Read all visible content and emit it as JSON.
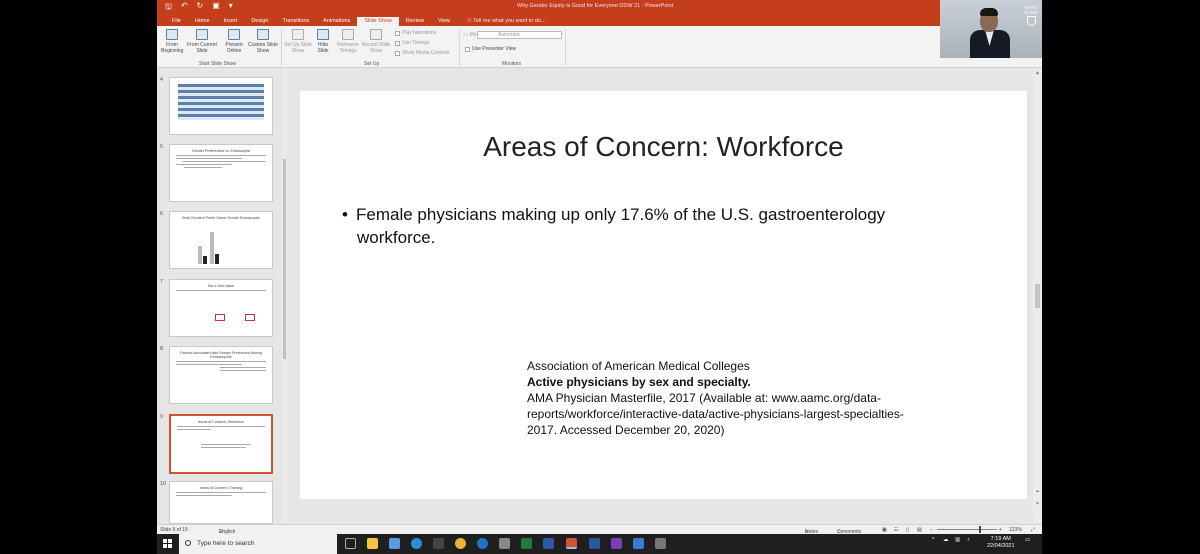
{
  "app": {
    "window_title": "Why Gender Equity is Good for Everyone  DDW 21  -  PowerPoint",
    "colors": {
      "accent": "#c43e1c",
      "selection": "#d35230",
      "taskbar": "#1f1f1f"
    }
  },
  "quick_access": [
    "save-icon",
    "undo-icon",
    "redo-icon",
    "present-icon",
    "dropdown-icon"
  ],
  "ribbon": {
    "tabs": [
      "File",
      "Home",
      "Insert",
      "Design",
      "Transitions",
      "Animations",
      "Slide Show",
      "Review",
      "View"
    ],
    "active_tab": "Slide Show",
    "tell_me": "Tell me what you want to do...",
    "start_slide_show": {
      "label": "Start Slide Show",
      "buttons": [
        "From Beginning",
        "From Current Slide",
        "Present Online",
        "Custom Slide Show"
      ]
    },
    "set_up": {
      "label": "Set Up",
      "buttons": [
        "Set Up Slide Show",
        "Hide Slide",
        "Rehearse Timings",
        "Record Slide Show"
      ],
      "checks": [
        "Play Narrations",
        "Use Timings",
        "Show Media Controls"
      ]
    },
    "monitors": {
      "label": "Monitors",
      "monitor_label": "Monitor:",
      "monitor_value": "Automatic",
      "presenter_view": "Use Presenter View"
    }
  },
  "thumbnails": [
    {
      "num": "4",
      "title": "",
      "selected": false
    },
    {
      "num": "5",
      "title": "Gender Preferences for Endoscopist",
      "selected": false
    },
    {
      "num": "6",
      "title": "Both Genders Prefer Same-Gender Endoscopist",
      "selected": false
    },
    {
      "num": "7",
      "title": "Not a New Issue",
      "selected": false
    },
    {
      "num": "8",
      "title": "Factors Associated with Gender Preference Among Endoscopists",
      "selected": false
    },
    {
      "num": "9",
      "title": "Areas of Concern: Workforce",
      "selected": true
    },
    {
      "num": "10",
      "title": "Areas of Concern: Training",
      "selected": false
    }
  ],
  "slide": {
    "title": "Areas of Concern: Workforce",
    "bullet_line1": "Female physicians making up only 17.6% of the U.S. gastroenterology",
    "bullet_line2": "workforce.",
    "citation": {
      "org": "Association of American Medical Colleges",
      "title": "Active physicians by sex and specialty.",
      "line3": "AMA Physician Masterfile, 2017 (Available at: www.aamc.org/data-",
      "line4": "reports/workforce/interactive-data/active-physicians-largest-specialties-",
      "line5": "2017. Accessed December 20, 2020)"
    }
  },
  "status": {
    "slide_indicator": "Slide 9 of 15",
    "language": "English (United Kingdom)",
    "notes": "Notes",
    "comments": "Comments",
    "zoom": "123%"
  },
  "taskbar": {
    "search_placeholder": "Type here to search",
    "time": "7:19 AM",
    "date": "22/04/2021"
  },
  "webcam": {
    "logo_text": "MAYO CLINIC"
  }
}
